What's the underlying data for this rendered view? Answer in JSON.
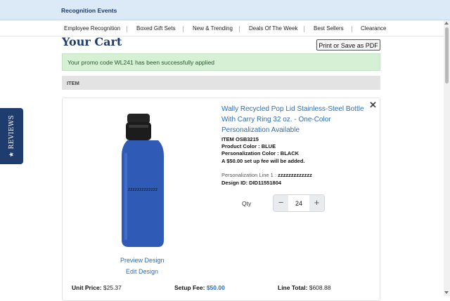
{
  "header": {
    "brand": "Recognition Events"
  },
  "nav": {
    "items": [
      "Employee Recognition",
      "Boxed Gift Sets",
      "New & Trending",
      "Deals Of The Week",
      "Best Sellers",
      "Clearance"
    ]
  },
  "page": {
    "title": "Your Cart",
    "print_button": "Print or Save as PDF",
    "promo_message": "Your promo code WL241 has been successfully applied",
    "item_column_header": "ITEM"
  },
  "product": {
    "title": "Wally Recycled Pop Lid Stainless-Steel Bottle With Carry Ring 32 oz. - One-Color Personalization Available",
    "item_number": "ITEM OSB3215",
    "product_color_label": "Product Color :",
    "product_color_value": "BLUE",
    "personalization_color_label": "Personalization Color :",
    "personalization_color_value": "BLACK",
    "setup_fee_note": "A $50.00 set up fee will be added.",
    "personalization_line_label": "Personalization Line 1 :",
    "personalization_line_value": "zzzzzzzzzzzzz",
    "design_id": "Design ID: DID11551804",
    "engraving_text": "zzzzzzzzzzzzz",
    "preview_link": "Preview Design",
    "edit_link": "Edit Design",
    "bottle_color": "#2f5bb7"
  },
  "quantity": {
    "label": "Qty",
    "value": "24",
    "minus": "−",
    "plus": "+"
  },
  "totals": {
    "unit_price_label": "Unit Price:",
    "unit_price_value": "$25.37",
    "setup_fee_label": "Setup Fee:",
    "setup_fee_value": "$50.00",
    "line_total_label": "Line Total:",
    "line_total_value": "$608.88"
  },
  "reviews_tab": {
    "label": "REVIEWS",
    "star": "★"
  },
  "icons": {
    "close": "close-icon",
    "star": "star-icon"
  }
}
